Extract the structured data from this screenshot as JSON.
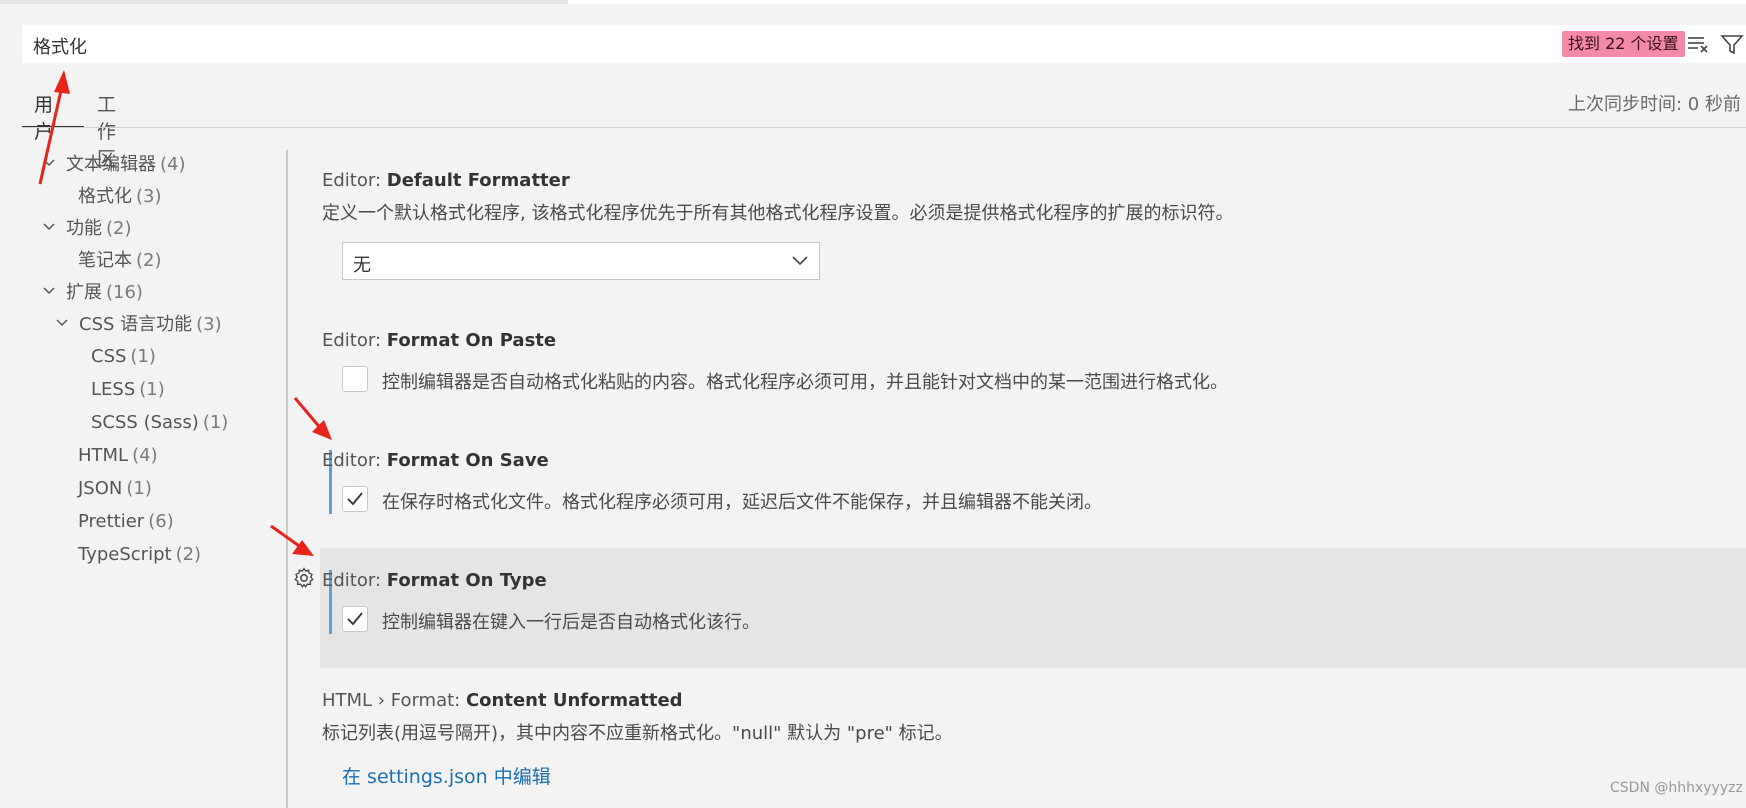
{
  "search": {
    "query": "格式化",
    "result_badge": "找到 22 个设置"
  },
  "tabs": [
    {
      "label": "用户"
    },
    {
      "label": "工作区"
    }
  ],
  "sync_status": "上次同步时间: 0 秒前",
  "toc": [
    {
      "label": "文本编辑器",
      "count": "(4)"
    },
    {
      "label": "格式化",
      "count": "(3)"
    },
    {
      "label": "功能",
      "count": "(2)"
    },
    {
      "label": "笔记本",
      "count": "(2)"
    },
    {
      "label": "扩展",
      "count": "(16)"
    },
    {
      "label": "CSS 语言功能",
      "count": "(3)"
    },
    {
      "label": "CSS",
      "count": "(1)"
    },
    {
      "label": "LESS",
      "count": "(1)"
    },
    {
      "label": "SCSS (Sass)",
      "count": "(1)"
    },
    {
      "label": "HTML",
      "count": "(4)"
    },
    {
      "label": "JSON",
      "count": "(1)"
    },
    {
      "label": "Prettier",
      "count": "(6)"
    },
    {
      "label": "TypeScript",
      "count": "(2)"
    }
  ],
  "settings": [
    {
      "category": "Editor: ",
      "name": "Default Formatter",
      "description": "定义一个默认格式化程序, 该格式化程序优先于所有其他格式化程序设置。必须是提供格式化程序的扩展的标识符。",
      "select_value": "无"
    },
    {
      "category": "Editor: ",
      "name": "Format On Paste",
      "description": "控制编辑器是否自动格式化粘贴的内容。格式化程序必须可用，并且能针对文档中的某一范围进行格式化。",
      "checked": false
    },
    {
      "category": "Editor: ",
      "name": "Format On Save",
      "description": "在保存时格式化文件。格式化程序必须可用，延迟后文件不能保存，并且编辑器不能关闭。",
      "checked": true
    },
    {
      "category": "Editor: ",
      "name": "Format On Type",
      "description": "控制编辑器在键入一行后是否自动格式化该行。",
      "checked": true
    },
    {
      "category": "HTML › Format: ",
      "name": "Content Unformatted",
      "description": "标记列表(用逗号隔开)，其中内容不应重新格式化。\"null\" 默认为 \"pre\" 标记。",
      "link": "在 settings.json 中编辑"
    }
  ],
  "watermark": "CSDN @hhhxyyyzz",
  "colors": {
    "badge": "#f28aa8",
    "modified_bar": "#5ca0d8",
    "link": "#1a6fb3",
    "annotation_arrow": "#e8231c"
  },
  "icons": [
    "clear-filter-icon",
    "filter-icon",
    "chevron-down-icon",
    "checkmark-icon",
    "gear-icon"
  ]
}
